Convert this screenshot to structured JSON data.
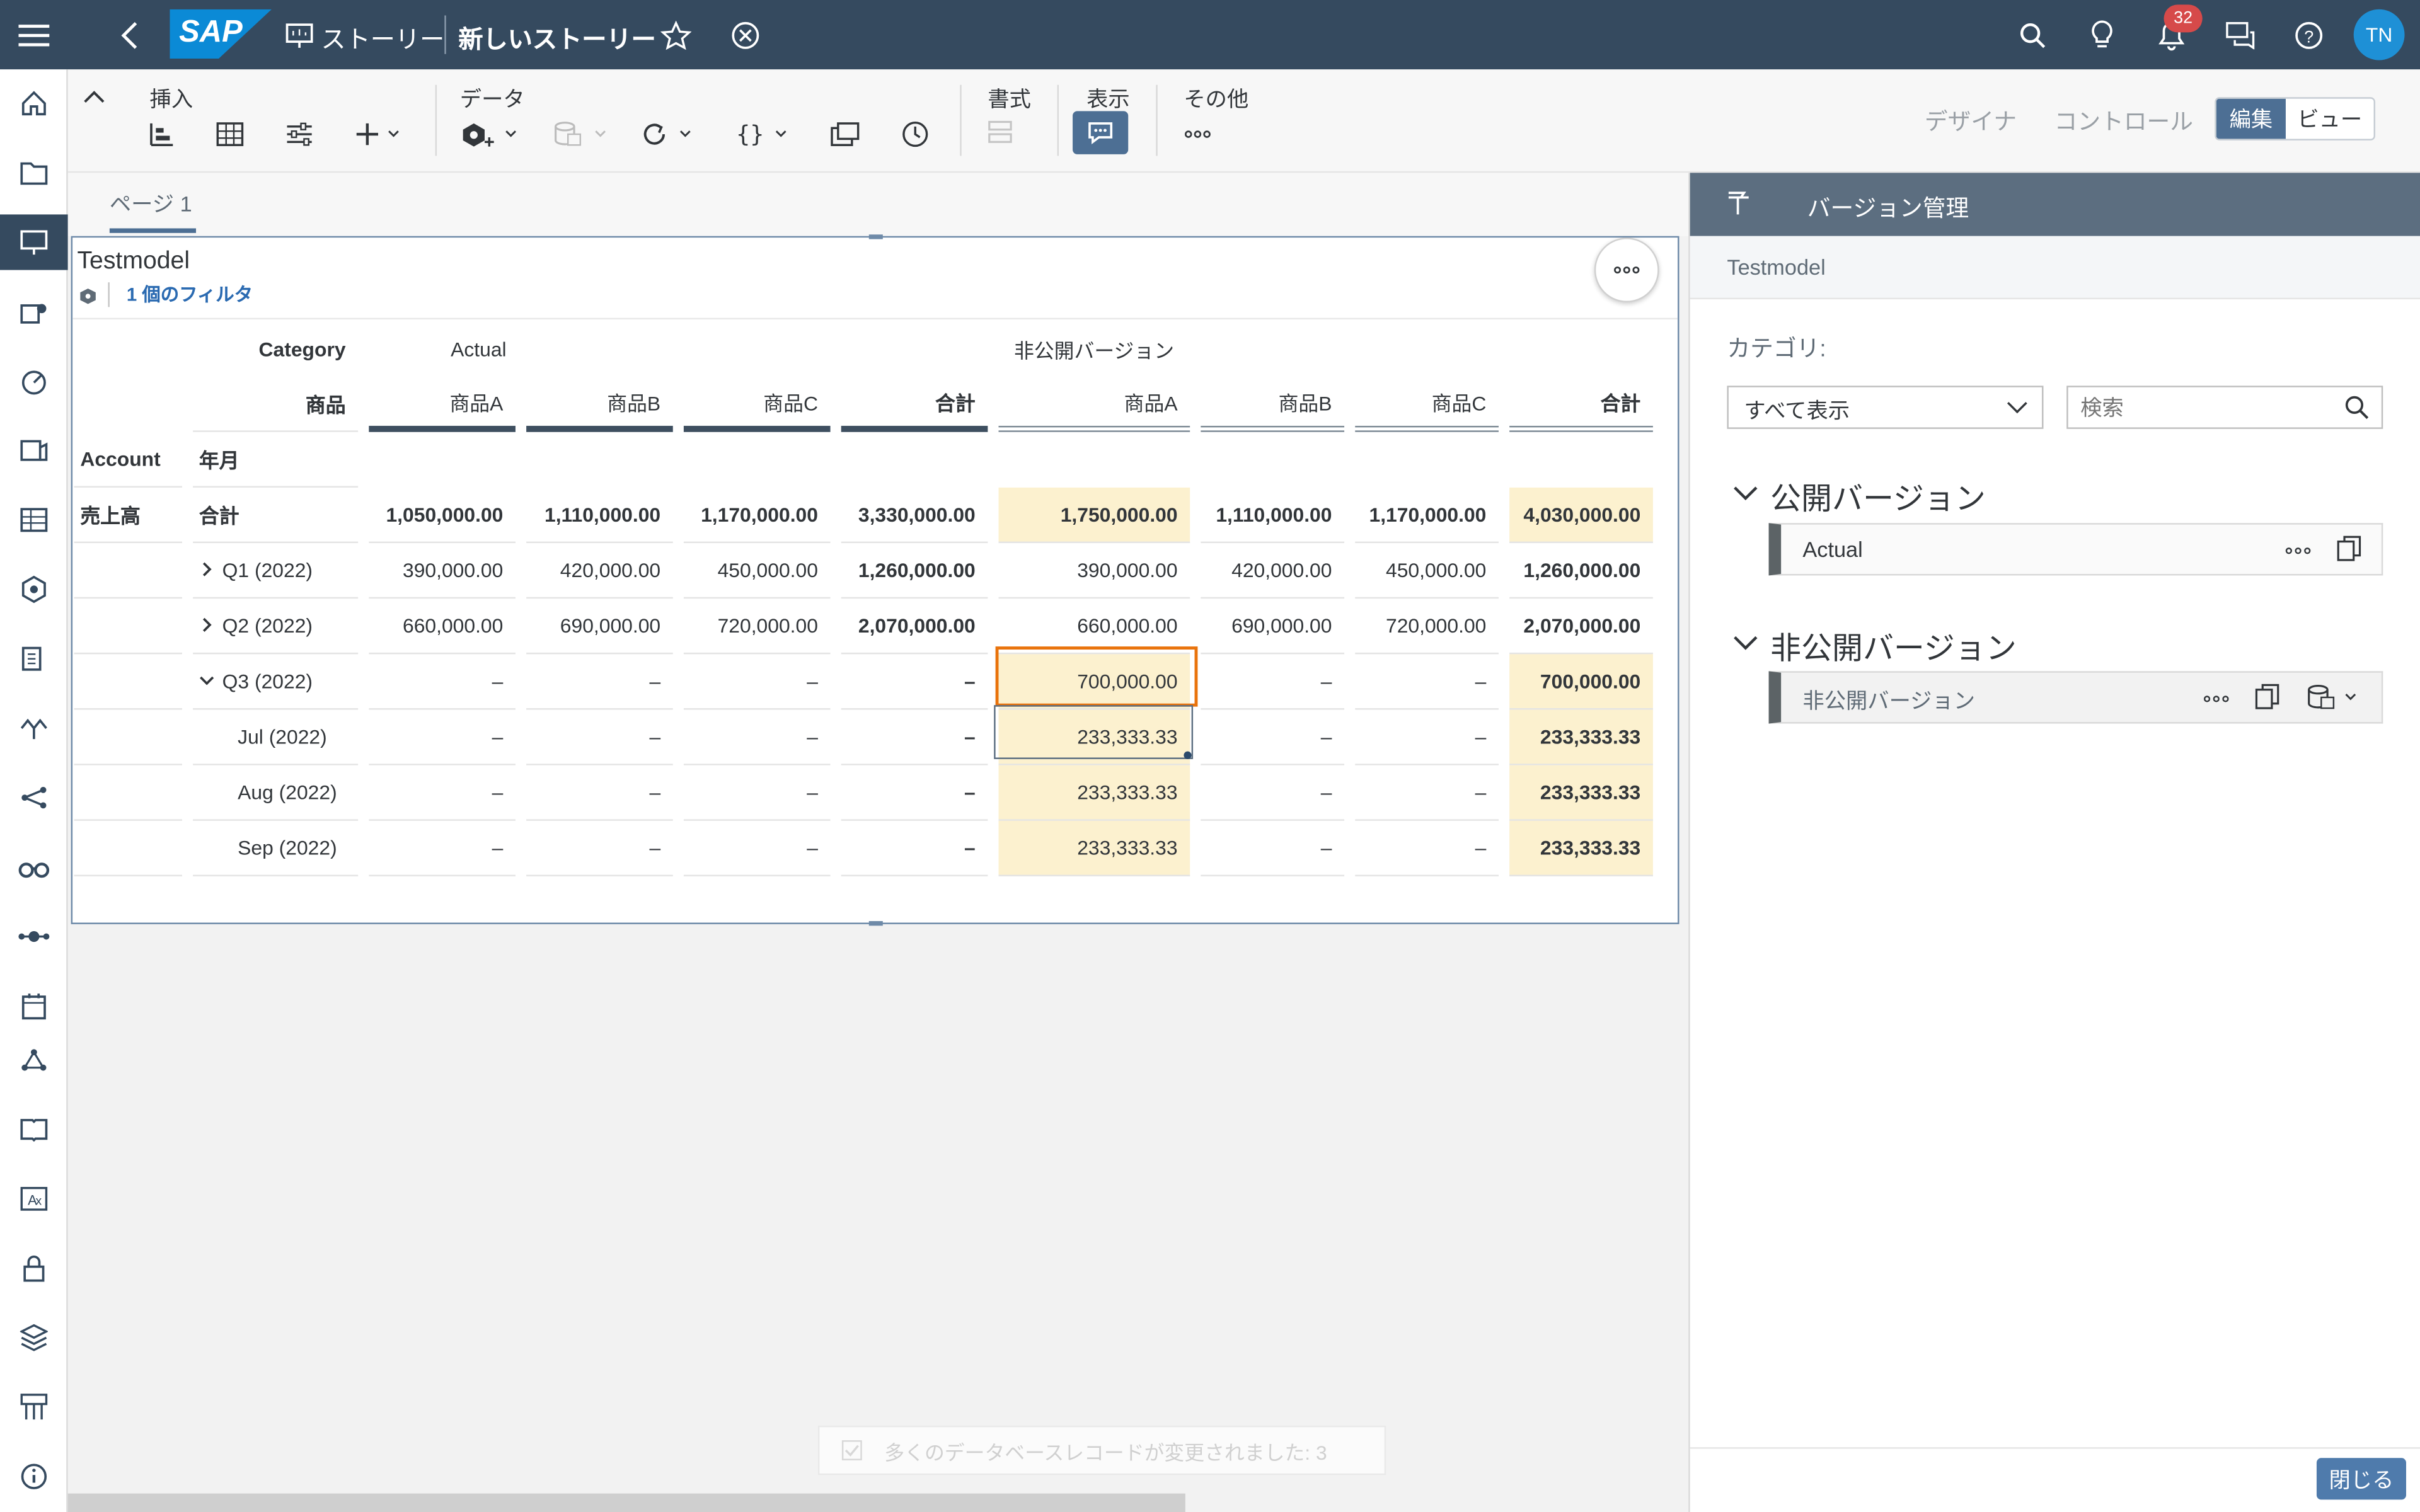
{
  "shell": {
    "story_icon_label": "ストーリー",
    "story_title": "新しいストーリー",
    "notification_count": "32",
    "avatar_initials": "TN"
  },
  "toolbar": {
    "insert_label": "挿入",
    "data_label": "データ",
    "format_label": "書式",
    "display_label": "表示",
    "other_label": "その他",
    "designer_label": "デザイナ",
    "control_label": "コントロール",
    "edit_label": "編集",
    "view_label": "ビュー"
  },
  "page_tab": "ページ 1",
  "widget": {
    "title": "Testmodel",
    "filter_text": "1 個のフィルタ"
  },
  "table": {
    "category_label": "Category",
    "product_label": "商品",
    "account_label": "Account",
    "yearmonth_label": "年月",
    "actual_header": "Actual",
    "private_header": "非公開バージョン",
    "col_headers": [
      "商品A",
      "商品B",
      "商品C",
      "合計",
      "商品A",
      "商品B",
      "商品C",
      "合計"
    ],
    "rows": [
      {
        "account": "売上高",
        "period": "合計",
        "values": [
          "1,050,000.00",
          "1,110,000.00",
          "1,170,000.00",
          "3,330,000.00",
          "1,750,000.00",
          "1,110,000.00",
          "1,170,000.00",
          "4,030,000.00"
        ]
      },
      {
        "account": "",
        "period": "Q1 (2022)",
        "values": [
          "390,000.00",
          "420,000.00",
          "450,000.00",
          "1,260,000.00",
          "390,000.00",
          "420,000.00",
          "450,000.00",
          "1,260,000.00"
        ]
      },
      {
        "account": "",
        "period": "Q2 (2022)",
        "values": [
          "660,000.00",
          "690,000.00",
          "720,000.00",
          "2,070,000.00",
          "660,000.00",
          "690,000.00",
          "720,000.00",
          "2,070,000.00"
        ]
      },
      {
        "account": "",
        "period": "Q3 (2022)",
        "values": [
          "–",
          "–",
          "–",
          "–",
          "700,000.00",
          "–",
          "–",
          "700,000.00"
        ]
      },
      {
        "account": "",
        "period": "Jul (2022)",
        "values": [
          "–",
          "–",
          "–",
          "–",
          "233,333.33",
          "–",
          "–",
          "233,333.33"
        ]
      },
      {
        "account": "",
        "period": "Aug (2022)",
        "values": [
          "–",
          "–",
          "–",
          "–",
          "233,333.33",
          "–",
          "–",
          "233,333.33"
        ]
      },
      {
        "account": "",
        "period": "Sep (2022)",
        "values": [
          "–",
          "–",
          "–",
          "–",
          "233,333.33",
          "–",
          "–",
          "233,333.33"
        ]
      }
    ]
  },
  "panel": {
    "title": "バージョン管理",
    "model": "Testmodel",
    "category_label": "カテゴリ:",
    "category_value": "すべて表示",
    "search_placeholder": "検索",
    "public_section": "公開バージョン",
    "public_version": "Actual",
    "private_section": "非公開バージョン",
    "private_version": "非公開バージョン",
    "close_label": "閉じる"
  },
  "toast": "多くのデータベースレコードが変更されました: 3"
}
